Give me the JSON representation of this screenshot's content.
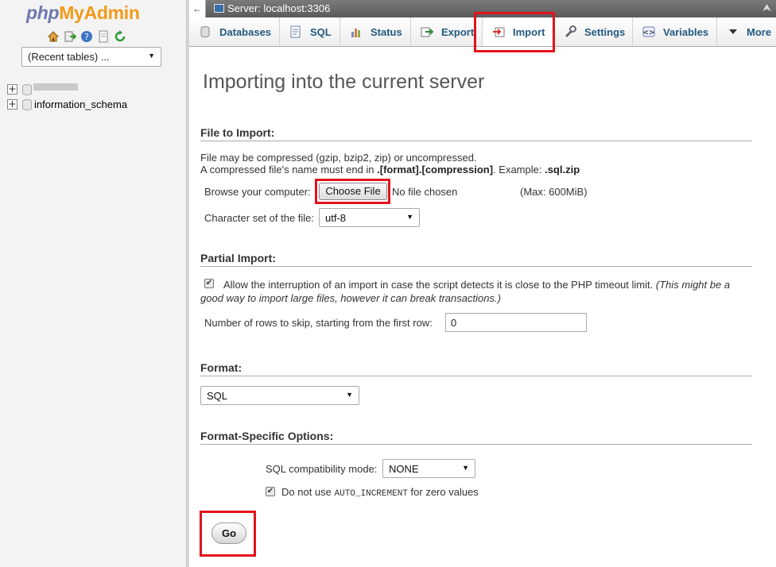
{
  "app": {
    "logo_php": "php",
    "logo_myadmin": "MyAdmin",
    "colors": {
      "link": "#235a81",
      "highlight": "#e4121c",
      "logo_blue": "#6c78af",
      "logo_orange": "#f29a1a"
    }
  },
  "nav": {
    "icons": [
      "home-icon",
      "logout-icon",
      "help-icon",
      "docs-icon",
      "reload-icon"
    ],
    "recent_tables": "(Recent tables) ...",
    "databases": [
      {
        "label": ""
      },
      {
        "label": "information_schema"
      }
    ]
  },
  "serverbar": {
    "back": "←",
    "server": "Server: localhost:3306",
    "collapse": "⮝"
  },
  "tabs": [
    {
      "label": "Databases",
      "icon": "database-icon"
    },
    {
      "label": "SQL",
      "icon": "sql-icon"
    },
    {
      "label": "Status",
      "icon": "status-icon"
    },
    {
      "label": "Export",
      "icon": "export-icon"
    },
    {
      "label": "Import",
      "icon": "import-icon",
      "active": true
    },
    {
      "label": "Settings",
      "icon": "settings-icon"
    },
    {
      "label": "Variables",
      "icon": "variables-icon"
    },
    {
      "label": "More",
      "icon": "chevron-down-icon"
    }
  ],
  "main": {
    "title": "Importing into the current server",
    "file_section": {
      "heading": "File to Import:",
      "line1": "File may be compressed (gzip, bzip2, zip) or uncompressed.",
      "line2_prefix": "A compressed file's name must end in ",
      "line2_bold": ".[format].[compression]",
      "line2_mid": ". Example: ",
      "line2_example": ".sql.zip",
      "browse_label": "Browse your computer:",
      "choose_button": "Choose File",
      "no_file": "No file chosen",
      "max_size": "(Max: 600MiB)",
      "charset_label": "Character set of the file:",
      "charset_value": "utf-8"
    },
    "partial_section": {
      "heading": "Partial Import:",
      "allow_interrupt_checked": true,
      "allow_interrupt_text": "Allow the interruption of an import in case the script detects it is close to the PHP timeout limit.",
      "allow_interrupt_note_1": "(This might be a",
      "allow_interrupt_note_2": "good way to import large files, however it can break transactions.)",
      "skip_label": "Number of rows to skip, starting from the first row:",
      "skip_value": "0"
    },
    "format_section": {
      "heading": "Format:",
      "value": "SQL"
    },
    "format_options": {
      "heading": "Format-Specific Options:",
      "compat_label": "SQL compatibility mode:",
      "compat_value": "NONE",
      "no_autoinc_checked": true,
      "no_autoinc_prefix": "Do not use ",
      "no_autoinc_code": "AUTO_INCREMENT",
      "no_autoinc_suffix": " for zero values"
    },
    "go_button": "Go"
  }
}
